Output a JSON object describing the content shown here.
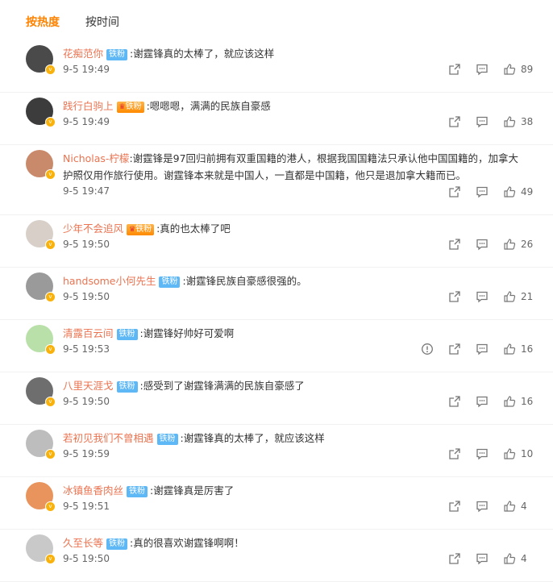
{
  "tabs": [
    {
      "label": "按热度",
      "active": true
    },
    {
      "label": "按时间",
      "active": false
    }
  ],
  "comments": [
    {
      "user": "花痴范你",
      "badge": "铁粉",
      "badge_type": "fan",
      "text": ":谢霆锋真的太棒了，就应该这样",
      "time": "9-5 19:49",
      "likes": "89",
      "avatar_color": "#4a4a4a"
    },
    {
      "user": "践行白驹上",
      "badge": "铁粉",
      "badge_type": "crown",
      "text": ":嗯嗯嗯，满满的民族自豪感",
      "time": "9-5 19:49",
      "likes": "38",
      "avatar_color": "#3c3c3c"
    },
    {
      "user": "Nicholas-柠檬",
      "badge": "",
      "badge_type": "none",
      "text": ":谢霆锋是97回归前拥有双重国籍的港人，根据我国国籍法只承认他中国国籍的，加拿大护照仅用作旅行使用。谢霆锋本来就是中国人，一直都是中国籍，他只是退加拿大籍而已。",
      "time": "9-5 19:47",
      "likes": "49",
      "avatar_color": "#c98a6b"
    },
    {
      "user": "少年不会追风",
      "badge": "铁粉",
      "badge_type": "crown",
      "text": ":真的也太棒了吧",
      "time": "9-5 19:50",
      "likes": "26",
      "avatar_color": "#d8cfc8"
    },
    {
      "user": "handsome小何先生",
      "badge": "铁粉",
      "badge_type": "fan",
      "text": ":谢霆锋民族自豪感很强的。",
      "time": "9-5 19:50",
      "likes": "21",
      "avatar_color": "#9a9a9a"
    },
    {
      "user": "清露百云间",
      "badge": "铁粉",
      "badge_type": "fan",
      "text": ":谢霆锋好帅好可爱啊",
      "time": "9-5 19:53",
      "likes": "16",
      "avatar_color": "#b9e0a8",
      "report": true
    },
    {
      "user": "八里天涯戈",
      "badge": "铁粉",
      "badge_type": "fan",
      "text": ":感受到了谢霆锋满满的民族自豪感了",
      "time": "9-5 19:50",
      "likes": "16",
      "avatar_color": "#6e6e6e"
    },
    {
      "user": "若初见我们不曾相遇",
      "badge": "铁粉",
      "badge_type": "fan",
      "text": ":谢霆锋真的太棒了，就应该这样",
      "time": "9-5 19:59",
      "likes": "10",
      "avatar_color": "#bdbdbd"
    },
    {
      "user": "冰镇鱼香肉丝",
      "badge": "铁粉",
      "badge_type": "fan",
      "text": ":谢霆锋真是厉害了",
      "time": "9-5 19:51",
      "likes": "4",
      "avatar_color": "#e8945c"
    },
    {
      "user": "久至长等",
      "badge": "铁粉",
      "badge_type": "fan",
      "text": ":真的很喜欢谢霆锋啊啊！",
      "time": "9-5 19:50",
      "likes": "4",
      "avatar_color": "#c9c9c9"
    }
  ],
  "icons": {
    "share": "share-icon",
    "comment": "comment-icon",
    "like": "like-icon",
    "report": "report-icon"
  },
  "colors": {
    "active_tab": "#ff8200",
    "username": "#eb7350",
    "fan_badge": "#5fb8f6"
  }
}
